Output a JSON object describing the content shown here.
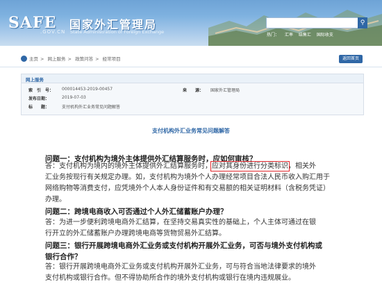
{
  "header": {
    "logo_text": "SAFE",
    "logo_domain": ".GOV.CN",
    "cn_title": "国家外汇管理局",
    "en_title": "State Administration of Foreign Exchange",
    "search_icon": "search-icon",
    "hot_links": [
      "热门：",
      "汇率",
      "结售汇",
      "国际收支"
    ]
  },
  "breadcrumb": {
    "home_icon": "home-icon",
    "items": [
      "主页",
      "网上服务",
      "政策问答",
      "经常项目"
    ],
    "separator": ">",
    "back_label": "返回首页"
  },
  "info": {
    "section_label": "网上服务",
    "index_key": "索　引　号：",
    "index_value": "000014453-2019-00457",
    "source_key": "来　　源：",
    "source_value": "国家外汇管理局",
    "date_key": "发布日期：",
    "date_value": "2019-07-03",
    "subject_key": "标　　题：",
    "subject_value": "支付机构外汇业务常见问题解答"
  },
  "article": {
    "title": "支付机构外汇业务常见问题解答",
    "q1": "问题一：支付机构为境外主体提供外汇结算服务时，应如何审核？",
    "a1_l1_pre": "答：支付机构为境内的境外主体提供外汇结算服务时，",
    "a1_l1_hl": "应对其身份进行分类标识",
    "a1_l1_post": "，相关外",
    "a1_l2": "汇业务按现行有关规定办理。如，支付机构为境外个人办理经常项目合法人民币收入购汇用于",
    "a1_l3": "网络购物等消费支付，应凭境外个人本人身份证件和有交易额的相关证明材料（含税务凭证）",
    "a1_l4": "办理。",
    "q2": "问题二：跨境电商收入可否通过个人外汇储蓄账户办理？",
    "a2_l1": "答：为进一步便利跨境电商外汇结算，在坚持交易真实性的基础上，个人主体可通过在银",
    "a2_l2": "行开立的外汇储蓄账户办理跨境电商等货物贸易外汇结算。",
    "q3_l1": "问题三：银行开展跨境电商外汇业务或支付机构开展外汇业务，可否与境外支付机构或",
    "q3_l2": "银行合作？",
    "a3_l1": "答：银行开展跨境电商外汇业务或支付机构开展外汇业务，可与符合当地法律要求的境外",
    "a3_l2": "支付机构或银行合作。但不得协助所合作的境外支付机构或银行在境内违规展业。"
  },
  "colors": {
    "accent": "#2f67a6",
    "highlight_border": "#e0262b"
  }
}
